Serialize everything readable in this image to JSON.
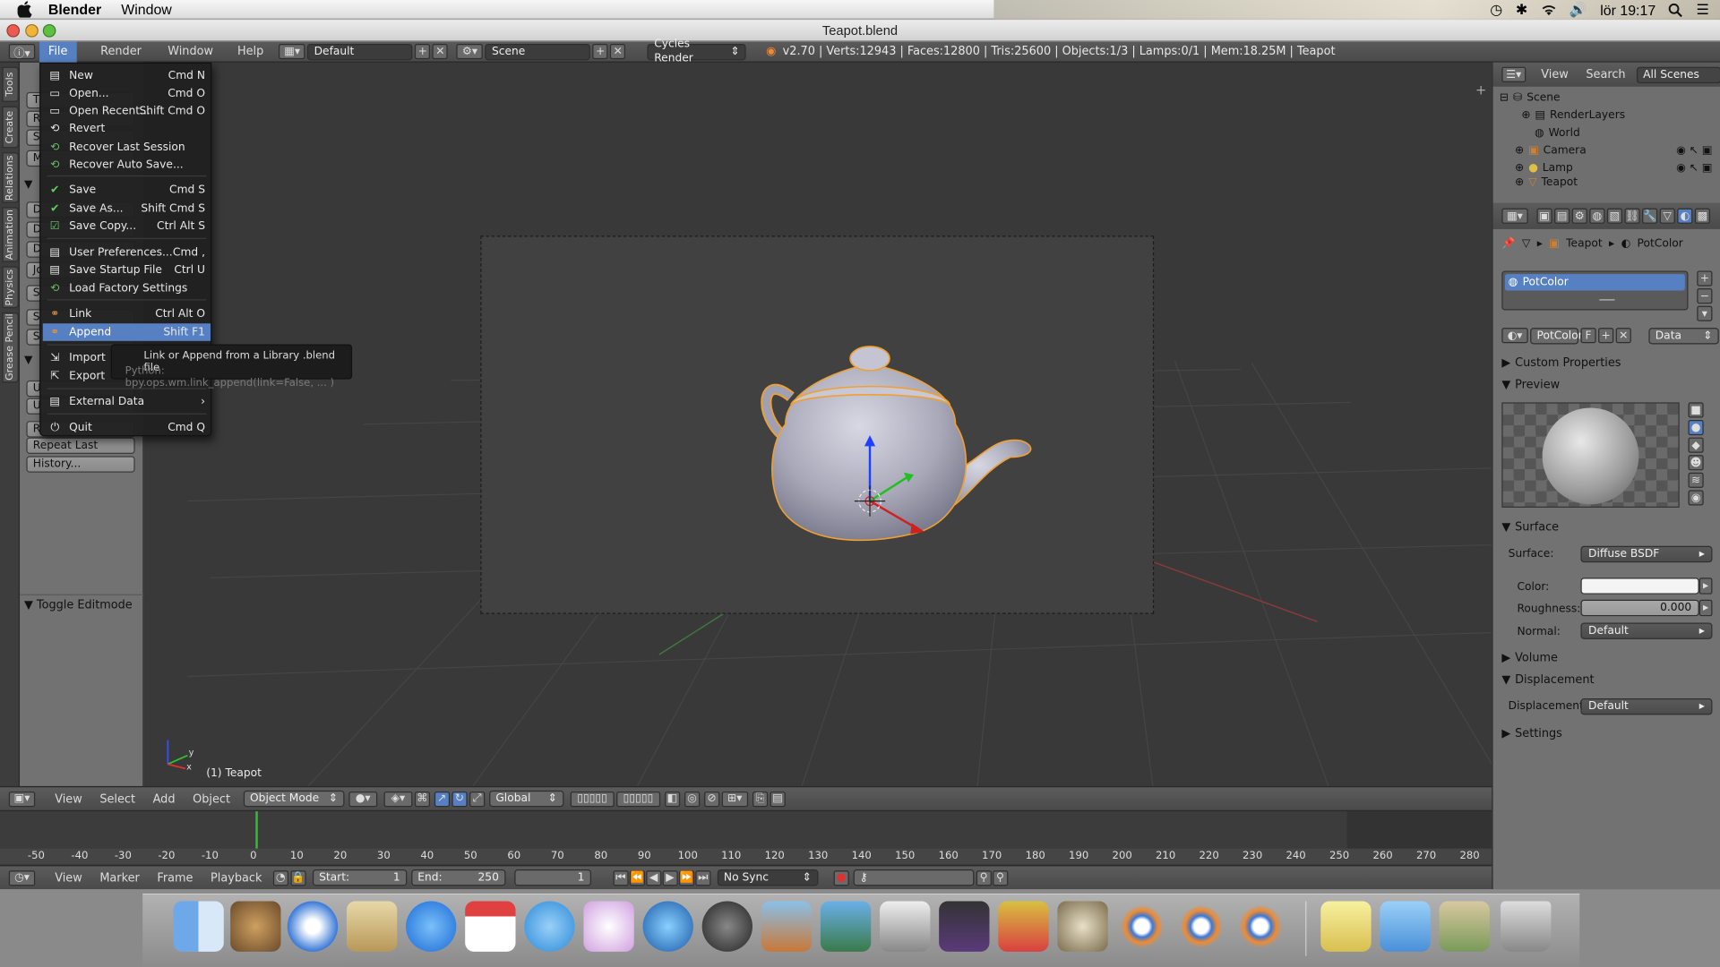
{
  "mac": {
    "app_name": "Blender",
    "menu_window": "Window",
    "clock": "lör 19:17"
  },
  "window_title": "Teapot.blend",
  "info_header": {
    "menus": [
      "File",
      "Render",
      "Window",
      "Help"
    ],
    "layout": "Default",
    "scene": "Scene",
    "engine": "Cycles Render",
    "stats": "v2.70 | Verts:12943 | Faces:12800 | Tris:25600 | Objects:1/3 | Lamps:0/1 | Mem:18.25M | Teapot"
  },
  "tool_tabs": [
    "Tools",
    "Create",
    "Relations",
    "Animation",
    "Physics",
    "Grease Pencil"
  ],
  "toolshelf": {
    "repeat_last": "Repeat Last",
    "history": "History...",
    "toggle_editmode": "Toggle Editmode",
    "partial_sp": "sp"
  },
  "file_menu": {
    "items": [
      {
        "label": "New",
        "shortcut": "Cmd N"
      },
      {
        "label": "Open...",
        "shortcut": "Cmd O"
      },
      {
        "label": "Open Recent...",
        "shortcut": "Shift Cmd O"
      },
      {
        "label": "Revert",
        "shortcut": ""
      },
      {
        "label": "Recover Last Session",
        "shortcut": ""
      },
      {
        "label": "Recover Auto Save...",
        "shortcut": ""
      },
      {
        "label": "Save",
        "shortcut": "Cmd S"
      },
      {
        "label": "Save As...",
        "shortcut": "Shift Cmd S"
      },
      {
        "label": "Save Copy...",
        "shortcut": "Ctrl Alt S"
      },
      {
        "label": "User Preferences...",
        "shortcut": "Cmd ,"
      },
      {
        "label": "Save Startup File",
        "shortcut": "Ctrl U"
      },
      {
        "label": "Load Factory Settings",
        "shortcut": ""
      },
      {
        "label": "Link",
        "shortcut": "Ctrl Alt O"
      },
      {
        "label": "Append",
        "shortcut": "Shift F1"
      },
      {
        "label": "Import",
        "shortcut": ""
      },
      {
        "label": "Export",
        "shortcut": ""
      },
      {
        "label": "External Data",
        "shortcut": ""
      },
      {
        "label": "Quit",
        "shortcut": "Cmd Q"
      }
    ],
    "selected": "Append"
  },
  "tooltip": {
    "title": "Link or Append from a Library .blend file",
    "python": "Python: bpy.ops.wm.link_append(link=False, ... )"
  },
  "viewport": {
    "object_label": "(1) Teapot"
  },
  "view3d_header": {
    "menus": [
      "View",
      "Select",
      "Add",
      "Object"
    ],
    "mode": "Object Mode",
    "orientation": "Global"
  },
  "timeline": {
    "ticks": [
      "-50",
      "-40",
      "-30",
      "-20",
      "-10",
      "0",
      "10",
      "20",
      "30",
      "40",
      "50",
      "60",
      "70",
      "80",
      "90",
      "100",
      "110",
      "120",
      "130",
      "140",
      "150",
      "160",
      "170",
      "180",
      "190",
      "200",
      "210",
      "220",
      "230",
      "240",
      "250",
      "260",
      "270",
      "280"
    ],
    "current_frame": 1
  },
  "timeline_header": {
    "menus": [
      "View",
      "Marker",
      "Frame",
      "Playback"
    ],
    "start_label": "Start:",
    "start": "1",
    "end_label": "End:",
    "end": "250",
    "frame": "1",
    "sync": "No Sync"
  },
  "outliner": {
    "menus": [
      "View",
      "Search"
    ],
    "filter": "All Scenes",
    "rows": [
      {
        "label": "Scene"
      },
      {
        "label": "RenderLayers"
      },
      {
        "label": "World"
      },
      {
        "label": "Camera"
      },
      {
        "label": "Lamp"
      },
      {
        "label": "Teapot"
      }
    ]
  },
  "properties": {
    "breadcrumb_object": "Teapot",
    "breadcrumb_material": "PotColor",
    "material_slot": "PotColor",
    "material_name": "PotColor",
    "fake_user": "F",
    "link": "Data",
    "panels": {
      "custom_properties": "Custom Properties",
      "preview": "Preview",
      "surface": "Surface",
      "volume": "Volume",
      "displacement": "Displacement",
      "settings": "Settings"
    },
    "surface_label": "Surface:",
    "surface_value": "Diffuse BSDF",
    "color_label": "Color:",
    "roughness_label": "Roughness:",
    "roughness_value": "0.000",
    "normal_label": "Normal:",
    "normal_value": "Default",
    "displacement_label": "Displacement:",
    "displacement_value": "Default"
  },
  "colors": {
    "selection": "#5680c2",
    "teapot_outline": "#f0a030"
  }
}
